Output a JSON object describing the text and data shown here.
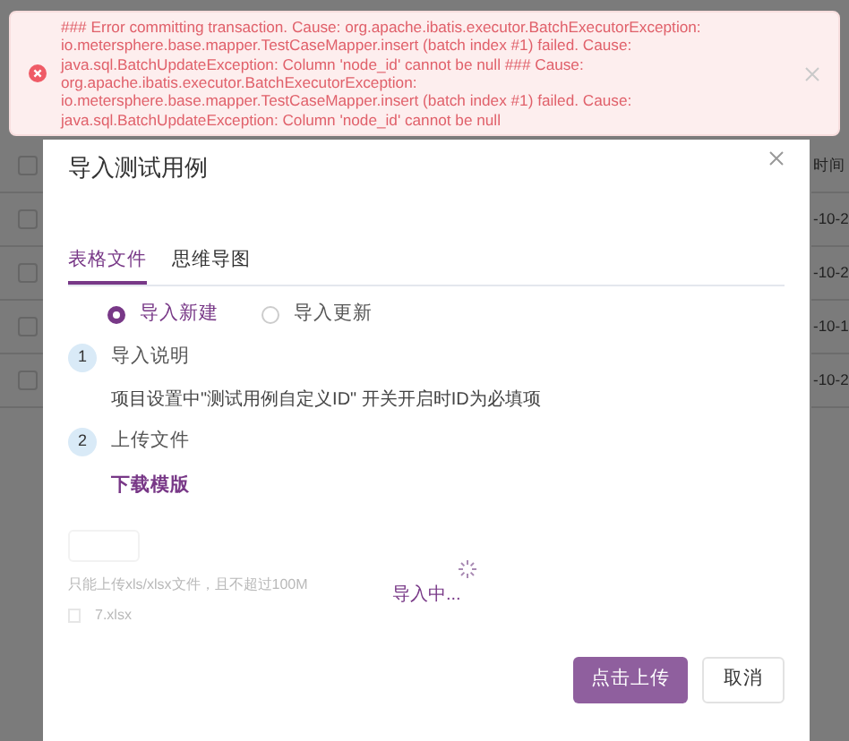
{
  "background_table": {
    "header": "时间",
    "header_checked": false,
    "rows": [
      {
        "date": "-10-2",
        "checked": false
      },
      {
        "date": "-10-2",
        "checked": false
      },
      {
        "date": "-10-1",
        "checked": false
      },
      {
        "date": "-10-2",
        "checked": false
      }
    ]
  },
  "alert": {
    "message": "### Error committing transaction. Cause: org.apache.ibatis.executor.BatchExecutorException: io.metersphere.base.mapper.TestCaseMapper.insert (batch index #1) failed. Cause: java.sql.BatchUpdateException: Column 'node_id' cannot be null ### Cause: org.apache.ibatis.executor.BatchExecutorException: io.metersphere.base.mapper.TestCaseMapper.insert (batch index #1) failed. Cause: java.sql.BatchUpdateException: Column 'node_id' cannot be null"
  },
  "dialog": {
    "title": "导入测试用例",
    "tabs": [
      {
        "label": "表格文件",
        "selected": true
      },
      {
        "label": "思维导图",
        "selected": false
      }
    ],
    "modes": [
      {
        "label": "导入新建",
        "selected": true
      },
      {
        "label": "导入更新",
        "selected": false
      }
    ],
    "steps": [
      {
        "number": "1",
        "title": "导入说明",
        "body": "项目设置中\"测试用例自定义ID\" 开关开启时ID为必填项",
        "kind": "text"
      },
      {
        "number": "2",
        "title": "上传文件",
        "body": "下载模版",
        "kind": "link"
      }
    ],
    "upload_hint": "只能上传xls/xlsx文件，且不超过100M",
    "file_name": "7.xlsx",
    "loading": "导入中...",
    "buttons": [
      {
        "label": "点击上传",
        "kind": "primary"
      },
      {
        "label": "取消",
        "kind": "secondary"
      }
    ]
  }
}
